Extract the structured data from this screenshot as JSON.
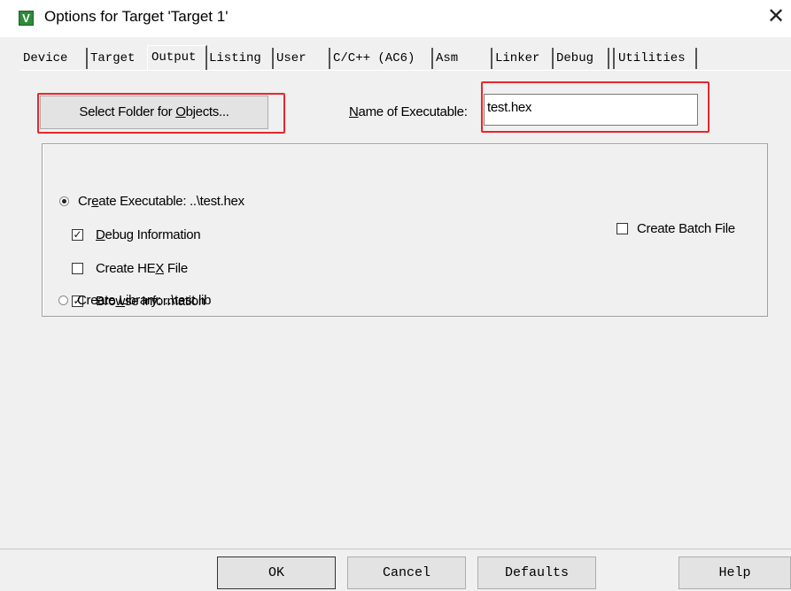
{
  "window": {
    "title": "Options for Target 'Target 1'",
    "app_icon": "V",
    "close_glyph": "✕"
  },
  "tabs": [
    {
      "label": "Device",
      "active": false
    },
    {
      "label": "Target",
      "active": false
    },
    {
      "label": "Output",
      "active": true
    },
    {
      "label": "Listing",
      "active": false
    },
    {
      "label": "User",
      "active": false
    },
    {
      "label": "C/C++ (AC6)",
      "active": false
    },
    {
      "label": "Asm",
      "active": false
    },
    {
      "label": "Linker",
      "active": false
    },
    {
      "label": "Debug",
      "active": false
    },
    {
      "label": "Utilities",
      "active": false
    }
  ],
  "output": {
    "select_folder_button": {
      "before": "Select Folder for ",
      "underlined": "O",
      "after": "bjects..."
    },
    "name_of_executable_label": {
      "underlined": "N",
      "after": "ame of Executable:"
    },
    "name_of_executable_value": "test.hex",
    "create_executable": {
      "before": "Cr",
      "underlined": "e",
      "after": "ate Executable:  ..\\test.hex",
      "selected": true
    },
    "debug_information": {
      "underlined": "D",
      "after": "ebug Information",
      "checked": true
    },
    "create_hex_file": {
      "before": "Create HE",
      "underlined": "X",
      "after": " File",
      "checked": false
    },
    "browse_information": {
      "before": "Bro",
      "underlined": "w",
      "after": "se Information",
      "checked": true
    },
    "create_library": {
      "label": "Create Library:  ..\\test.lib",
      "selected": false
    },
    "create_batch_file": {
      "label": "Create Batch File",
      "checked": false
    }
  },
  "footer": {
    "ok": "OK",
    "cancel": "Cancel",
    "defaults": "Defaults",
    "help": "Help"
  },
  "colors": {
    "highlight_box": "#e8262b",
    "dialog_bg": "#f0f0f0"
  }
}
